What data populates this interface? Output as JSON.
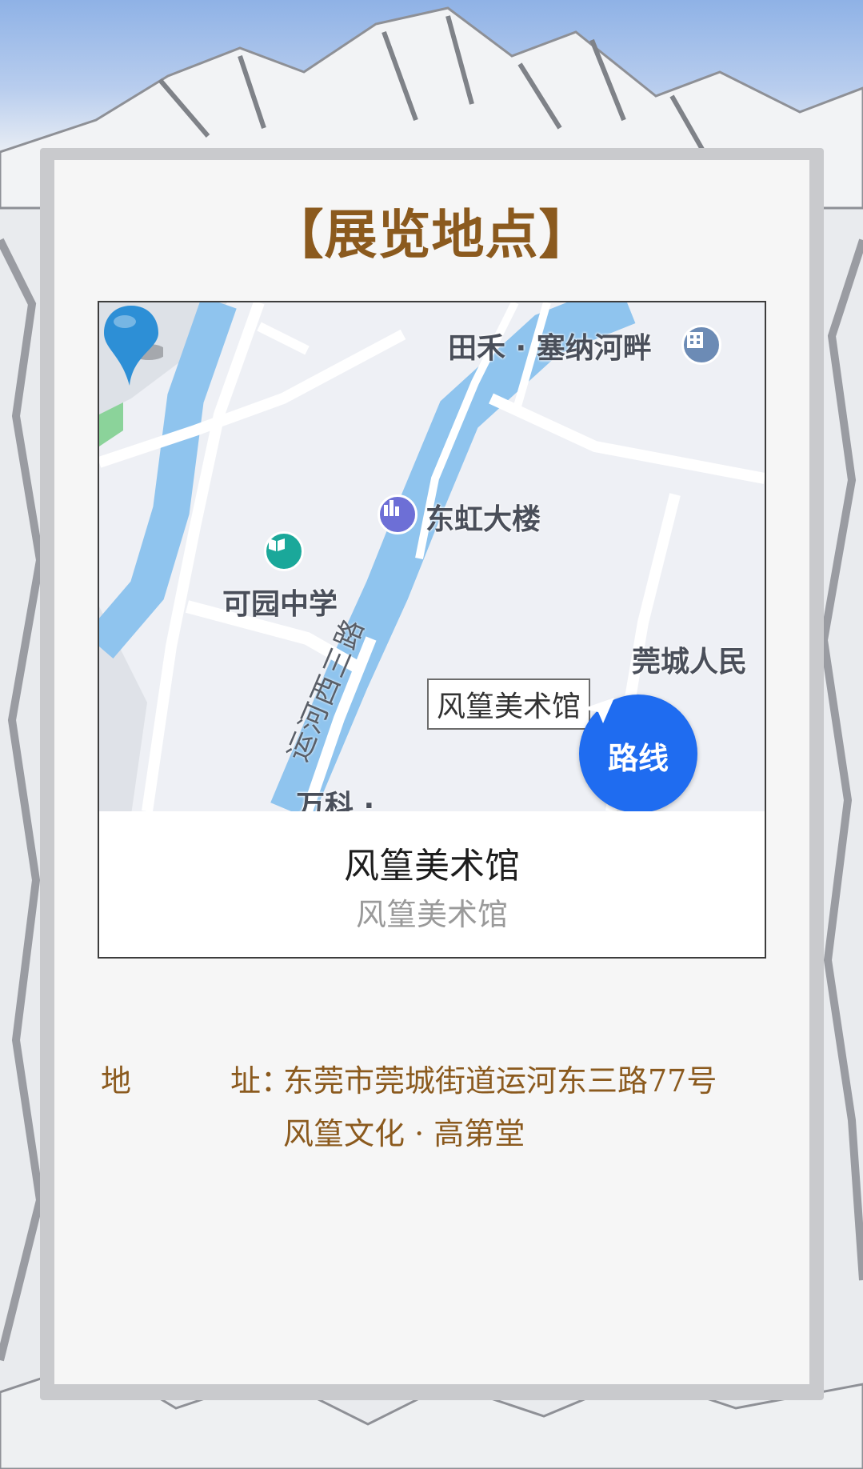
{
  "heading": "【展览地点】",
  "map": {
    "pois": {
      "tianhe": "田禾 · 塞纳河畔",
      "donghong": "东虹大楼",
      "keyuan": "可园中学",
      "guancheng": "莞城人民",
      "wanke": "万科 ·"
    },
    "road_name": "运河西三路",
    "callout": "风篁美术馆",
    "route_button": "路线"
  },
  "place": {
    "name": "风篁美术馆",
    "subtitle": "风篁美术馆"
  },
  "address": {
    "label_char1": "地",
    "label_char2": "址",
    "colon": "：",
    "line1": "东莞市莞城街道运河东三路77号",
    "line2": "风篁文化 · 高第堂"
  },
  "colors": {
    "accent_brown": "#8b5a1e",
    "route_blue": "#1f6cf0",
    "river_blue": "#8fc4ee",
    "pin_blue": "#2d8fd6"
  },
  "icons": [
    "building-icon",
    "school-icon",
    "navigate-arrow-icon",
    "location-pin-icon"
  ]
}
